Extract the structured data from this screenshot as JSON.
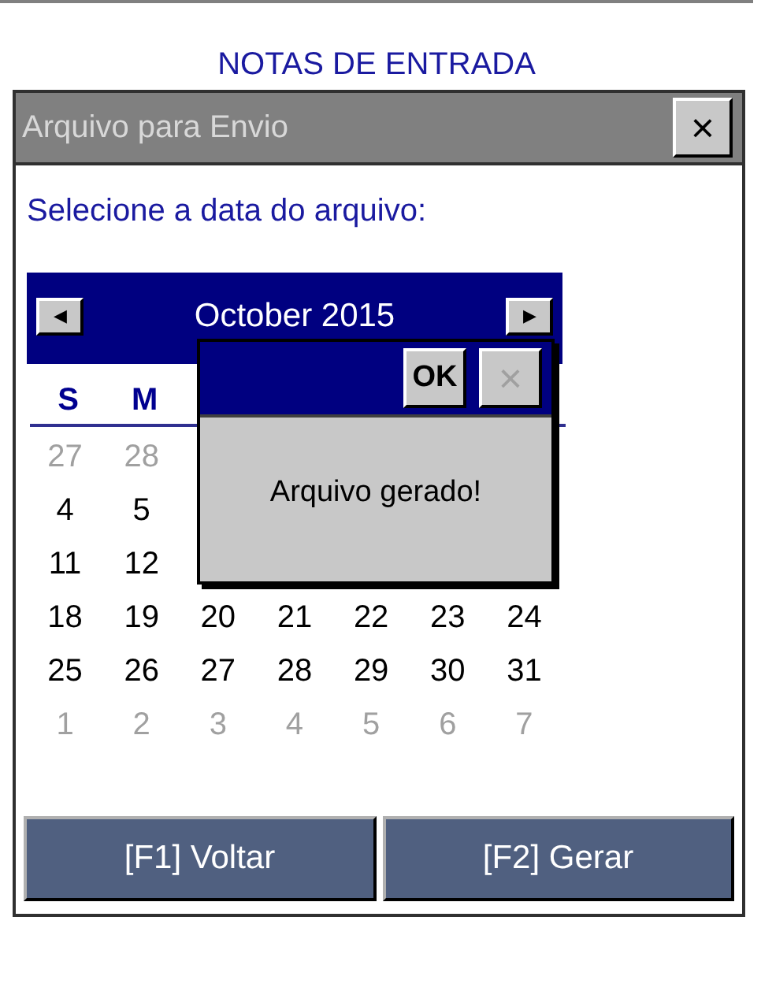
{
  "header": {
    "title": "NOTAS DE ENTRADA"
  },
  "window": {
    "title": "Arquivo para Envio",
    "close": "×"
  },
  "prompt": "Selecione a data do arquivo:",
  "calendar": {
    "month": "October 2015",
    "prev": "◀",
    "next": "▶",
    "weekdays": [
      "S",
      "M"
    ],
    "weeks": [
      [
        {
          "day": "27",
          "other_month": true
        },
        {
          "day": "28",
          "other_month": true
        }
      ],
      [
        {
          "day": "4",
          "other_month": false
        },
        {
          "day": "5",
          "other_month": false
        }
      ],
      [
        {
          "day": "11",
          "other_month": false
        },
        {
          "day": "12",
          "other_month": false
        }
      ],
      [
        {
          "day": "18",
          "other_month": false
        },
        {
          "day": "19",
          "other_month": false
        },
        {
          "day": "20",
          "other_month": false
        },
        {
          "day": "21",
          "other_month": false
        },
        {
          "day": "22",
          "other_month": false
        },
        {
          "day": "23",
          "other_month": false
        },
        {
          "day": "24",
          "other_month": false
        }
      ],
      [
        {
          "day": "25",
          "other_month": false
        },
        {
          "day": "26",
          "other_month": false
        },
        {
          "day": "27",
          "other_month": false
        },
        {
          "day": "28",
          "other_month": false
        },
        {
          "day": "29",
          "other_month": false
        },
        {
          "day": "30",
          "other_month": false
        },
        {
          "day": "31",
          "other_month": false
        }
      ],
      [
        {
          "day": "1",
          "other_month": true
        },
        {
          "day": "2",
          "other_month": true
        },
        {
          "day": "3",
          "other_month": true
        },
        {
          "day": "4",
          "other_month": true
        },
        {
          "day": "5",
          "other_month": true
        },
        {
          "day": "6",
          "other_month": true
        },
        {
          "day": "7",
          "other_month": true
        }
      ]
    ]
  },
  "message_box": {
    "ok": "OK",
    "close": "×",
    "close_disabled": true,
    "message": "Arquivo gerado!"
  },
  "buttons": [
    "[F1] Voltar",
    "[F2] Gerar"
  ]
}
